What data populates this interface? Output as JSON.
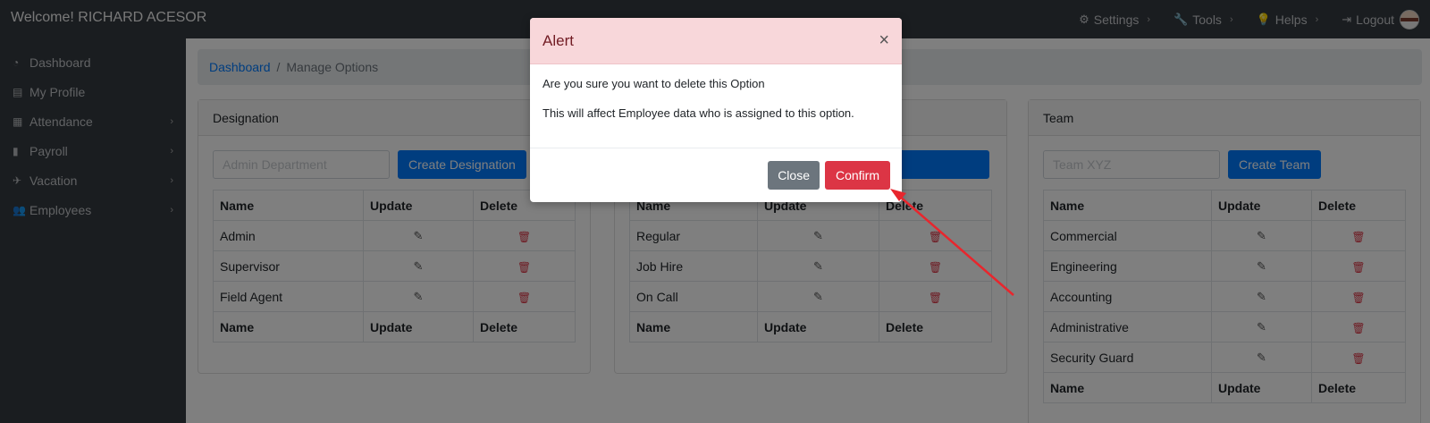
{
  "header": {
    "welcome": "Welcome! RICHARD ACESOR",
    "nav": [
      {
        "label": "Settings",
        "icon": "gears-icon"
      },
      {
        "label": "Tools",
        "icon": "wrench-icon"
      },
      {
        "label": "Helps",
        "icon": "lightbulb-icon"
      },
      {
        "label": "Logout",
        "icon": "logout-icon"
      }
    ]
  },
  "sidebar": {
    "items": [
      {
        "label": "Dashboard",
        "icon": "dashboard-icon",
        "has_children": false
      },
      {
        "label": "My Profile",
        "icon": "id-card-icon",
        "has_children": false
      },
      {
        "label": "Attendance",
        "icon": "calendar-icon",
        "has_children": true
      },
      {
        "label": "Payroll",
        "icon": "file-icon",
        "has_children": true
      },
      {
        "label": "Vacation",
        "icon": "plane-icon",
        "has_children": true
      },
      {
        "label": "Employees",
        "icon": "users-icon",
        "has_children": true
      }
    ]
  },
  "breadcrumb": {
    "root": "Dashboard",
    "separator": "/",
    "current": "Manage Options"
  },
  "designation": {
    "title": "Designation",
    "placeholder": "Admin Department",
    "button": "Create Designation",
    "headers": [
      "Name",
      "Update",
      "Delete"
    ],
    "rows": [
      "Admin",
      "Supervisor",
      "Field Agent"
    ]
  },
  "employment": {
    "headers": [
      "Name",
      "Update",
      "Delete"
    ],
    "rows": [
      "Regular",
      "Job Hire",
      "On Call"
    ]
  },
  "team": {
    "title": "Team",
    "placeholder": "Team XYZ",
    "button": "Create Team",
    "headers": [
      "Name",
      "Update",
      "Delete"
    ],
    "rows": [
      "Commercial",
      "Engineering",
      "Accounting",
      "Administrative",
      "Security Guard"
    ]
  },
  "modal": {
    "title": "Alert",
    "close_symbol": "×",
    "message1": "Are you sure you want to delete this Option",
    "message2": "This will affect Employee data who is assigned to this option.",
    "close_button": "Close",
    "confirm_button": "Confirm"
  },
  "colors": {
    "annotation_arrow": "#e8262d",
    "danger": "#dc3545",
    "primary": "#007bff"
  }
}
